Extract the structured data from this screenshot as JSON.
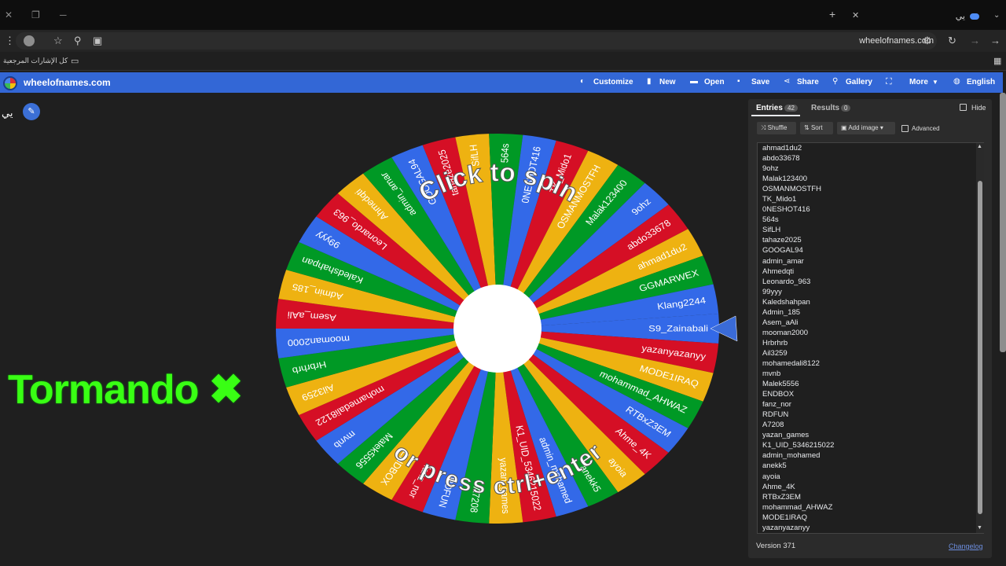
{
  "browser": {
    "url": "wheelofnames.com",
    "tab_title": "يي",
    "bookmarks_label": "كل الإشارات المرجعية"
  },
  "site": {
    "name": "wheelofnames.com",
    "nav": [
      "Customize",
      "New",
      "Open",
      "Save",
      "Share",
      "Gallery",
      "Fullscreen",
      "More",
      "English"
    ]
  },
  "wheel": {
    "title": "يي",
    "prompt_top": "Click to spin",
    "prompt_bottom": "or press ctrl+enter",
    "colors": [
      "#3369e8",
      "#d50f25",
      "#eeb211",
      "#009925"
    ]
  },
  "overlay": {
    "text": "Tormando ✖"
  },
  "panel": {
    "tab_entries": "Entries",
    "entries_count": "42",
    "tab_results": "Results",
    "results_count": "0",
    "hide_label": "Hide",
    "shuffle_label": "Shuffle",
    "sort_label": "Sort",
    "add_image_label": "Add image",
    "advanced_label": "Advanced",
    "version": "Version 371",
    "changelog": "Changelog"
  },
  "entries": [
    "ahmad1du2",
    "abdo33678",
    "9ohz",
    "Malak123400",
    "OSMANMOSTFH",
    "TK_Mido1",
    "0NESHOT416",
    "564s",
    "SifLH",
    "tahaze2025",
    "GOOGAL94",
    "admin_amar",
    "Ahmedqti",
    "Leonardo_963",
    "99yyy",
    "Kaledshahpan",
    "Admin_185",
    "Asem_aAli",
    "mooman2000",
    "Hrbrhrb",
    "Ail3259",
    "mohamedali8122",
    "mvnb",
    "Malek5556",
    "ENDBOX",
    "fanz_nor",
    "RDFUN",
    "A7208",
    "yazan_games",
    "K1_UID_5346215022",
    "admin_mohamed",
    "anekk5",
    "ayoia",
    "Ahme_4K",
    "RTBxZ3EM",
    "mohammad_AHWAZ",
    "MODE1IRAQ",
    "yazanyazanyy"
  ],
  "wheel_labels": [
    "S9_Zainabali",
    "yazanyazanyy",
    "MODE1IRAQ",
    "mohammad_AHWAZ",
    "RTBxZ3EM",
    "Ahme_4K",
    "ayoia",
    "anekk5",
    "admin_mohamed",
    "K1_UID_5346215022",
    "yazan_games",
    "A7208",
    "RDFUN",
    "fanz_nor",
    "ENDBOX",
    "Malek5556",
    "mvnb",
    "mohamedali8122",
    "Ail3259",
    "Hrbrhrb",
    "mooman2000",
    "Asem_aAli",
    "Admin_185",
    "Kaledshahpan",
    "99yyy",
    "Leonardo_963",
    "Ahmedqti",
    "admin_amar",
    "GOOGAL94",
    "tahaze2025",
    "SifLH",
    "564s",
    "0NESHOT416",
    "TK_Mido1",
    "OSMANMOSTFH",
    "Malak123400",
    "9ohz",
    "abdo33678",
    "ahmad1du2",
    "GGMARWEX",
    "Klang2244"
  ]
}
